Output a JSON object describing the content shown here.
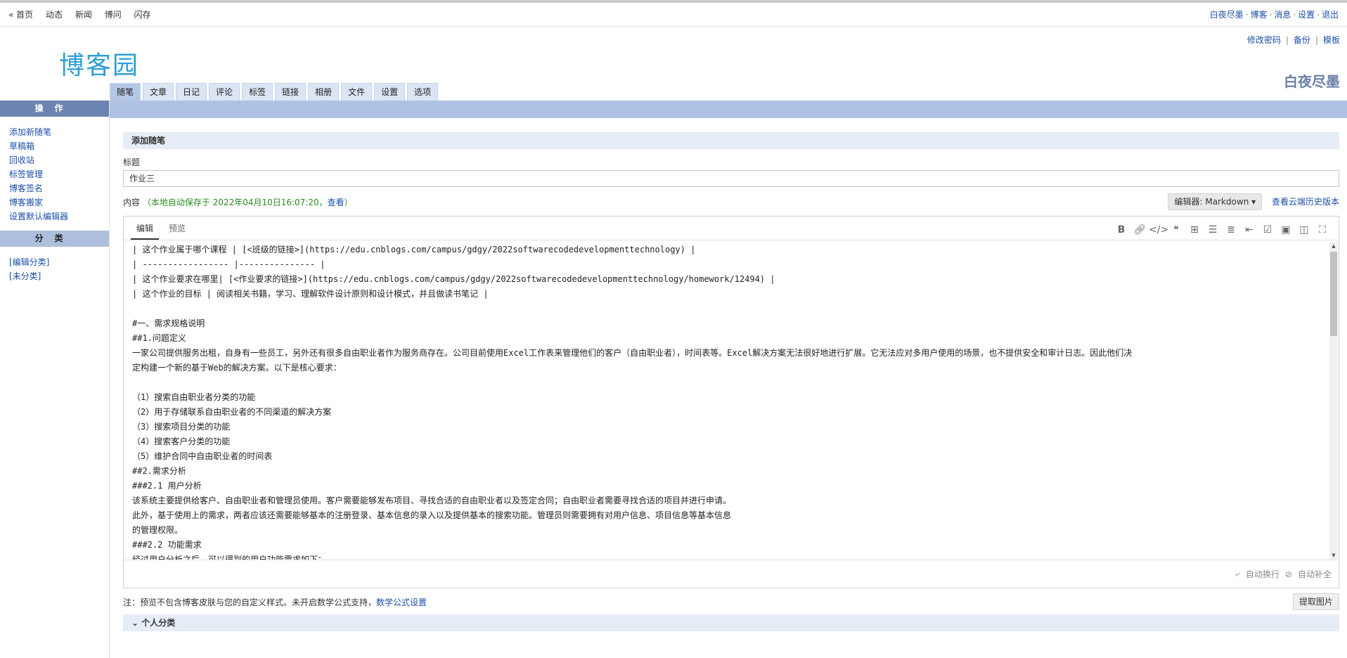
{
  "topbar": {
    "left": [
      "« 首页",
      "动态",
      "新闻",
      "博问",
      "闪存"
    ],
    "right": [
      "白夜尽墨",
      "博客",
      "消息",
      "设置",
      "退出"
    ]
  },
  "header": {
    "logo_text": "博客园",
    "links": [
      "修改密码",
      "备份",
      "模板"
    ],
    "blog_name": "白夜尽墨"
  },
  "tabs": [
    "随笔",
    "文章",
    "日记",
    "评论",
    "标签",
    "链接",
    "相册",
    "文件",
    "设置",
    "选项"
  ],
  "sidebar": {
    "ops_title": "操作",
    "ops": [
      "添加新随笔",
      "草稿箱",
      "回收站",
      "标签管理",
      "博客签名",
      "博客搬家",
      "设置默认编辑器"
    ],
    "cat_title": "分类",
    "cats": [
      "[编辑分类]",
      "[未分类]"
    ]
  },
  "form": {
    "section_title": "添加随笔",
    "title_label": "标题",
    "title_value": "作业三",
    "content_label": "内容",
    "autosave_text": "（本地自动保存于 2022年04月10日16:07:20，",
    "autosave_link": "查看",
    "autosave_end": "）",
    "editor_select": "编辑器: Markdown ▾",
    "cloud_history": "查看云端历史版本",
    "editor_tabs": [
      "编辑",
      "预览"
    ],
    "toolbar_icons": [
      "bold-icon",
      "link-icon",
      "code-icon",
      "quote-icon",
      "table-icon",
      "bullet-list-icon",
      "ordered-list-icon",
      "indent-icon",
      "checkbox-icon",
      "image-icon",
      "split-view-icon",
      "fullscreen-icon"
    ],
    "lines": [
      "| 这个作业属于哪个课程 | [<班级的链接>](https://edu.cnblogs.com/campus/gdgy/2022softwarecodedevelopmenttechnology) |",
      "| ----------------- |--------------- |",
      "| 这个作业要求在哪里| [<作业要求的链接>](https://edu.cnblogs.com/campus/gdgy/2022softwarecodedevelopmenttechnology/homework/12494) |",
      "| 这个作业的目标 | 阅读相关书籍，学习、理解软件设计原则和设计模式，并且做读书笔记 |",
      "",
      "#一、需求规格说明",
      "##1.问题定义",
      "一家公司提供服务出租，自身有一些员工，另外还有很多自由职业者作为服务商存在。公司目前使用Excel工作表来管理他们的客户（自由职业者），时间表等。Excel解决方案无法很好地进行扩展。它无法应对多用户使用的场景，也不提供安全和审计日志。因此他们决",
      "定构建一个新的基于Web的解决方案。以下是核心要求：",
      "",
      "（1）搜索自由职业者分类的功能",
      "（2）用于存储联系自由职业者的不同渠道的解决方案",
      "（3）搜索项目分类的功能",
      "（4）搜索客户分类的功能",
      "（5）维护合同中自由职业者的时间表",
      "##2.需求分析",
      "###2.1 用户分析",
      "该系统主要提供给客户、自由职业者和管理员使用。客户需要能够发布项目、寻找合适的自由职业者以及签定合同；自由职业者需要寻找合适的项目并进行申请。",
      "此外，基于使用上的需求，两者应该还需要能够基本的注册登录、基本信息的录入以及提供基本的搜索功能。管理员则需要拥有对用户信息、项目信息等基本信息",
      "的管理权限。",
      "###2.2 功能需求",
      "经过用户分析之后，可以得到的用户功能需求如下："
    ],
    "footer_wrap": "自动换行",
    "footer_complete": "自动补全",
    "note_text": "注：预览不包含博客皮肤与您的自定义样式。未开启数学公式支持，",
    "note_link": "数学公式设置",
    "grab_button": "提取图片",
    "category_title": "个人分类"
  }
}
